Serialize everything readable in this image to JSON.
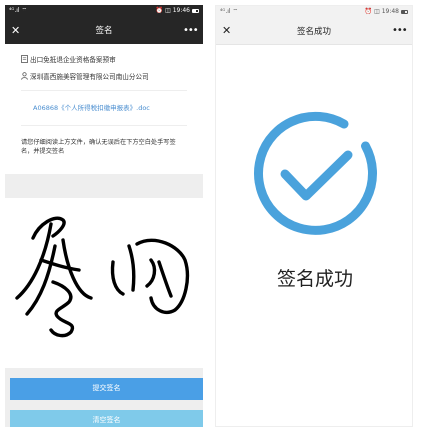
{
  "left": {
    "status": {
      "left": "⁴ᴳ.ıl ⌔",
      "right": "⏰ ◫ 19:46"
    },
    "title": "签名",
    "close": "✕",
    "more": "•••",
    "doc": {
      "title": "出口免抵退企业资格备案预审",
      "company": "深圳喜西施美容管理有限公司南山分公司",
      "file": "A06868《个人所得税扣缴申报表》.doc",
      "instruction": "请您仔细阅读上方文件，确认无误后在下方空白处手写签名，并提交签名"
    },
    "submit_label": "提交签名",
    "clear_label": "清空签名"
  },
  "right": {
    "status": {
      "left": "⁴ᴳ.ıl ⌔",
      "right": "⏰ ◫ 19:48"
    },
    "title": "签名成功",
    "close": "✕",
    "more": "•••",
    "success_text": "签名成功"
  },
  "colors": {
    "dark_header": "#262626",
    "light_header": "#f2f2f2",
    "link": "#4a8ed0",
    "primary_button": "#4a9fe6",
    "secondary_button": "#7fcaea",
    "success_ring": "#4aa2dc"
  }
}
